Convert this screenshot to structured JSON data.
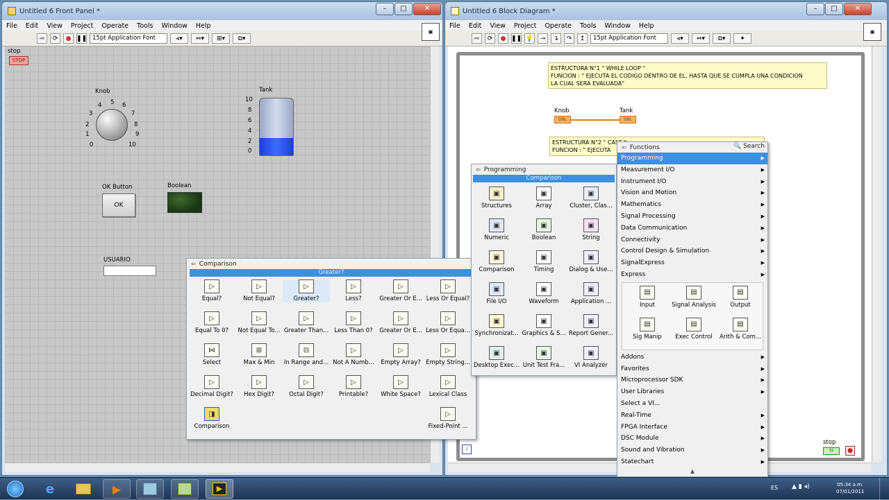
{
  "front_panel": {
    "title": "Untitled 6 Front Panel *",
    "menu": [
      "File",
      "Edit",
      "View",
      "Project",
      "Operate",
      "Tools",
      "Window",
      "Help"
    ],
    "font": "15pt Application Font",
    "stop_label": "stop",
    "stop_btn": "STOP",
    "knob_label": "Knob",
    "knob_ticks": [
      "0",
      "1",
      "2",
      "3",
      "4",
      "5",
      "6",
      "7",
      "8",
      "9",
      "10"
    ],
    "tank_label": "Tank",
    "tank_ticks": [
      "10",
      "8",
      "6",
      "4",
      "2",
      "0"
    ],
    "tank_level": 0.3,
    "ok_label": "OK Button",
    "ok_text": "OK",
    "boolean_label": "Boolean",
    "usuario_label": "USUARIO",
    "usuario_value": ""
  },
  "block_diagram": {
    "title": "Untitled 6 Block Diagram *",
    "menu": [
      "File",
      "Edit",
      "View",
      "Project",
      "Operate",
      "Tools",
      "Window",
      "Help"
    ],
    "font": "15pt Application Font",
    "comment1_lines": [
      "ESTRUCTURA N°1    \" WHILE LOOP \"",
      "FUNCION  : \" EJECUTA EL CODIGO DENTRO DE EL, HASTA QUE SE CUMPLA UNA CONDICION",
      "LA CUAL SERA EVALUADA\""
    ],
    "comment2_lines": [
      "ESTRUCTURA N°2    \" CASE \"",
      "FUNCION  :  \" EJECUTA"
    ],
    "knob_term_label": "Knob",
    "knob_term_text": "DBL",
    "tank_term_label": "Tank",
    "tank_term_text": "DBL",
    "stop_term_label": "stop",
    "stop_term_text": "TF",
    "loop_iter": "i"
  },
  "comparison_palette": {
    "title": "Comparison",
    "highlight": "Greater?",
    "items": [
      "Equal?",
      "Not Equal?",
      "Greater?",
      "Less?",
      "Greater Or E...",
      "Less Or Equal?",
      "Equal To 0?",
      "Not Equal To...",
      "Greater Than...",
      "Less Than 0?",
      "Greater Or E...",
      "Less Or Equa...",
      "Select",
      "Max & Min",
      "In Range and...",
      "Not A Numb...",
      "Empty Array?",
      "Empty String...",
      "Decimal Digit?",
      "Hex Digit?",
      "Octal Digit?",
      "Printable?",
      "White Space?",
      "Lexical Class",
      "Comparison",
      "Fixed-Point ..."
    ]
  },
  "programming_palette": {
    "title": "Programming",
    "highlight": "Comparison",
    "items": [
      "Structures",
      "Array",
      "Cluster, Clas...",
      "Numeric",
      "Boolean",
      "String",
      "Comparison",
      "Timing",
      "Dialog & Use...",
      "File I/O",
      "Waveform",
      "Application ...",
      "Synchronizat...",
      "Graphics & S...",
      "Report Gener...",
      "Desktop Exec...",
      "Unit Test Fra...",
      "VI Analyzer"
    ]
  },
  "functions_palette": {
    "title": "Functions",
    "search": "Search",
    "items_top": [
      "Programming",
      "Measurement I/O",
      "Instrument I/O",
      "Vision and Motion",
      "Mathematics",
      "Signal Processing",
      "Data Communication",
      "Connectivity",
      "Control Design & Simulation",
      "SignalExpress",
      "Express"
    ],
    "express_items": [
      "Input",
      "Signal Analysis",
      "Output",
      "Sig Manip",
      "Exec Control",
      "Arith & Com..."
    ],
    "items_bottom": [
      "Addons",
      "Favorites",
      "Microprocessor SDK",
      "User Libraries",
      "Select a VI...",
      "Real-Time",
      "FPGA Interface",
      "DSC Module",
      "Sound and Vibration",
      "Statechart"
    ]
  },
  "taskbar": {
    "lang": "ES",
    "time": "05:34 a.m.",
    "date": "07/01/2011"
  }
}
